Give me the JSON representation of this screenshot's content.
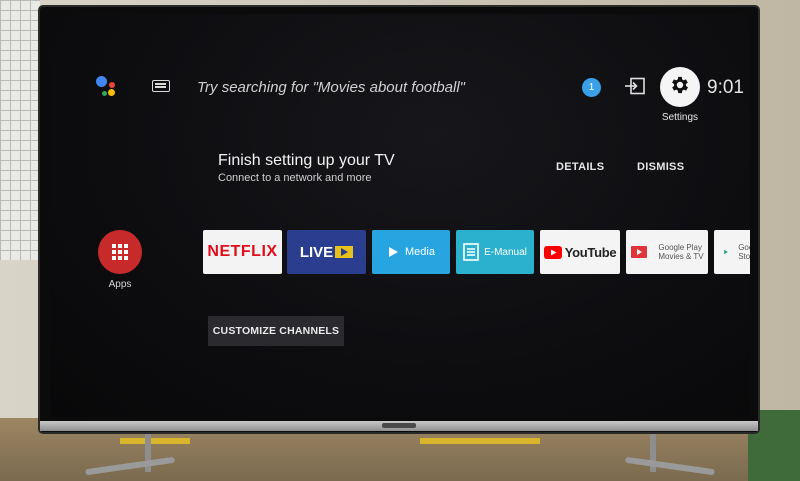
{
  "top_bar": {
    "search_prompt": "Try searching for \"Movies about football\"",
    "notification_count": "1",
    "settings_label": "Settings",
    "clock": "9:01"
  },
  "setup_card": {
    "title": "Finish setting up your TV",
    "subtitle": "Connect to a network and more",
    "details_label": "DETAILS",
    "dismiss_label": "DISMISS"
  },
  "apps": {
    "apps_label": "Apps",
    "tiles": [
      {
        "label": "NETFLIX"
      },
      {
        "label": "LIVE"
      },
      {
        "label": "Media"
      },
      {
        "label": "E-Manual"
      },
      {
        "label": "YouTube"
      },
      {
        "label_line1": "Google Play",
        "label_line2": "Movies & TV"
      },
      {
        "label_line1": "Google",
        "label_line2": "Store"
      }
    ]
  },
  "customize_label": "CUSTOMIZE CHANNELS",
  "colors": {
    "accent_blue": "#3aa0e8",
    "apps_red": "#c62a2a",
    "netflix_red": "#e20d1b",
    "youtube_red": "#ff0000"
  }
}
